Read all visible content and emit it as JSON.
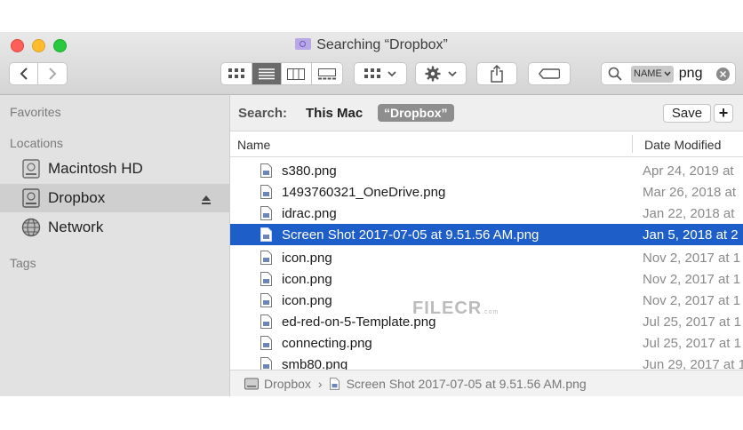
{
  "window": {
    "title": "Searching “Dropbox”"
  },
  "toolbar": {
    "search_token": "NAME",
    "search_value": "png"
  },
  "sidebar": {
    "favorites_heading": "Favorites",
    "locations_heading": "Locations",
    "tags_heading": "Tags",
    "items": [
      {
        "label": "Macintosh HD",
        "icon": "hard-drive-icon"
      },
      {
        "label": "Dropbox",
        "icon": "hard-drive-icon",
        "selected": true
      },
      {
        "label": "Network",
        "icon": "globe-icon"
      }
    ]
  },
  "search_scope": {
    "label": "Search:",
    "this_mac": "This Mac",
    "dropbox": "“Dropbox”",
    "save_label": "Save",
    "add_label": "+"
  },
  "columns": {
    "name": "Name",
    "date_modified": "Date Modified"
  },
  "files": [
    {
      "name": "s380.png",
      "date": "Apr 24, 2019 at"
    },
    {
      "name": "1493760321_OneDrive.png",
      "date": "Mar 26, 2018 at"
    },
    {
      "name": "idrac.png",
      "date": "Jan 22, 2018 at"
    },
    {
      "name": "Screen Shot 2017-07-05 at 9.51.56 AM.png",
      "date": "Jan 5, 2018 at 2",
      "selected": true
    },
    {
      "name": "icon.png",
      "date": "Nov 2, 2017 at 1"
    },
    {
      "name": "icon.png",
      "date": "Nov 2, 2017 at 1"
    },
    {
      "name": "icon.png",
      "date": "Nov 2, 2017 at 1"
    },
    {
      "name": "ed-red-on-5-Template.png",
      "date": "Jul 25, 2017 at 1"
    },
    {
      "name": "connecting.png",
      "date": "Jul 25, 2017 at 1"
    },
    {
      "name": "smb80.png",
      "date": "Jun 29, 2017 at 1"
    }
  ],
  "pathbar": {
    "folder": "Dropbox",
    "separator": "›",
    "file": "Screen Shot 2017-07-05 at 9.51.56 AM.png"
  },
  "watermark": {
    "text": "FILECR",
    "suffix": ".com"
  },
  "colors": {
    "selection": "#1e5ec8",
    "close": "#fe5f57",
    "minimize": "#febc2e",
    "zoom": "#28c840"
  }
}
